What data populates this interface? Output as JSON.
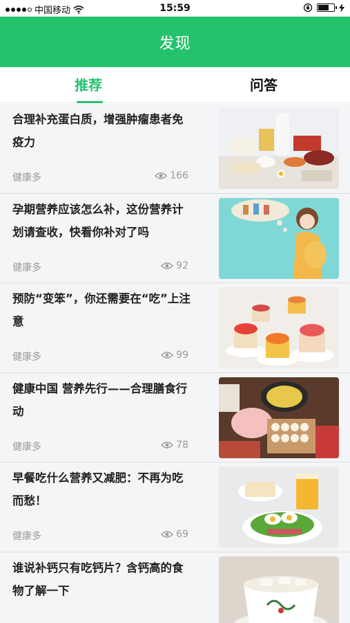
{
  "status_bar": {
    "carrier": "中国移动",
    "time": "15:59"
  },
  "app_bar": {
    "title": "发现"
  },
  "tabs": [
    {
      "label": "推荐",
      "active": true
    },
    {
      "label": "问答",
      "active": false
    }
  ],
  "articles": [
    {
      "title": "合理补充蛋白质，增强肿瘤患者免疫力",
      "source": "健康多",
      "views": "166",
      "image": "protein-foods"
    },
    {
      "title": "孕期营养应该怎么补，这份营养计划请查收，快看你补对了吗",
      "source": "健康多",
      "views": "92",
      "image": "pregnant-woman-illustration"
    },
    {
      "title": "预防“变笨”，你还需要在“吃”上注意",
      "source": "健康多",
      "views": "99",
      "image": "desserts"
    },
    {
      "title": "健康中国 营养先行——合理膳食行动",
      "source": "健康多",
      "views": "78",
      "image": "market-foods"
    },
    {
      "title": "早餐吃什么营养又减肥：不再为吃而愁！",
      "source": "健康多",
      "views": "69",
      "image": "breakfast-plate"
    },
    {
      "title": "谁说补钙只有吃钙片？含钙高的食物了解一下",
      "source": "",
      "views": "",
      "image": "tofu-soup"
    }
  ],
  "colors": {
    "brand_green": "#25c26e",
    "feed_bg": "#f4f5f7",
    "meta_gray": "#9a9a9a"
  }
}
